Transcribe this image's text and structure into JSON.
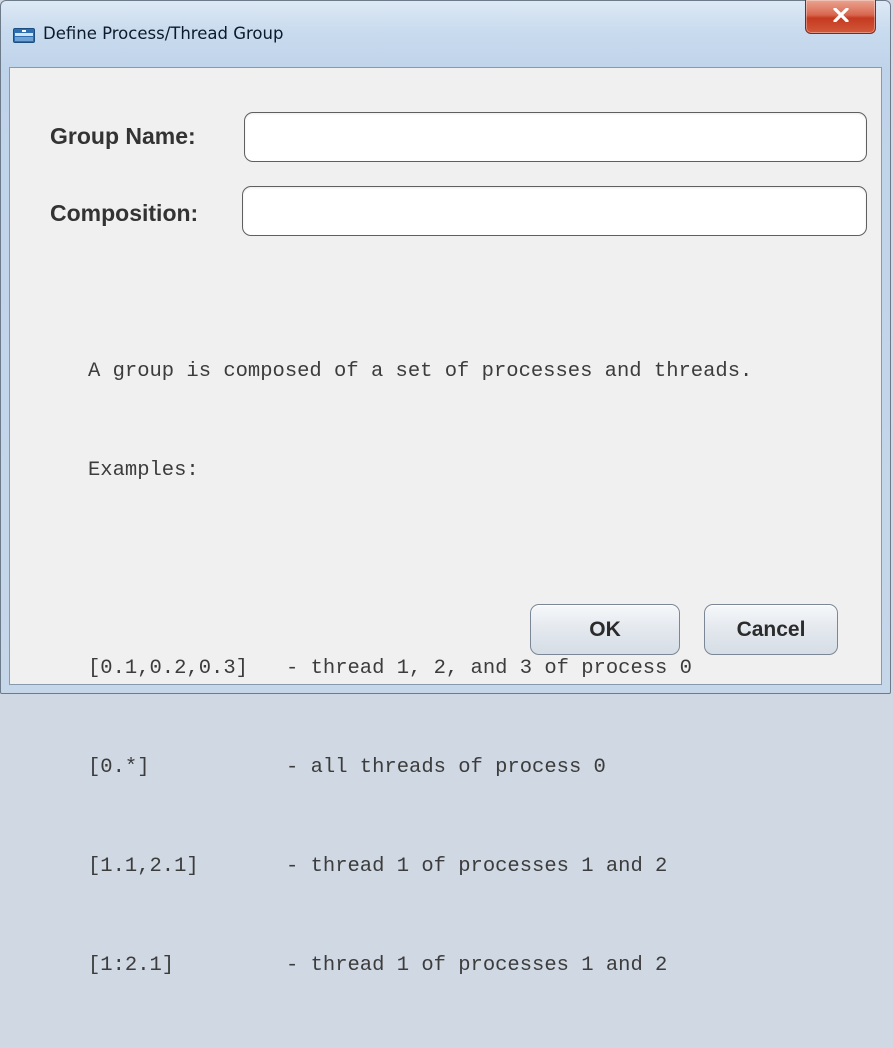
{
  "window": {
    "title": "Define Process/Thread Group",
    "icon": "app-window-icon",
    "close_icon": "close-icon"
  },
  "form": {
    "group_name_label": "Group Name:",
    "group_name_value": "",
    "composition_label": "Composition:",
    "composition_value": ""
  },
  "help": {
    "intro": "A group is composed of a set of processes and threads.",
    "examples_label": "Examples:",
    "examples": [
      {
        "pattern": "[0.1,0.2,0.3]",
        "description": "- thread 1, 2, and 3 of process 0"
      },
      {
        "pattern": "[0.*]",
        "description": "- all threads of process 0"
      },
      {
        "pattern": "[1.1,2.1]",
        "description": "- thread 1 of processes 1 and 2"
      },
      {
        "pattern": "[1:2.1]",
        "description": "- thread 1 of processes 1 and 2"
      }
    ]
  },
  "buttons": {
    "ok_label": "OK",
    "cancel_label": "Cancel"
  },
  "colors": {
    "titlebar": "#c9dbee",
    "close_button": "#c43a1f",
    "client_background": "#f0f0f0"
  }
}
